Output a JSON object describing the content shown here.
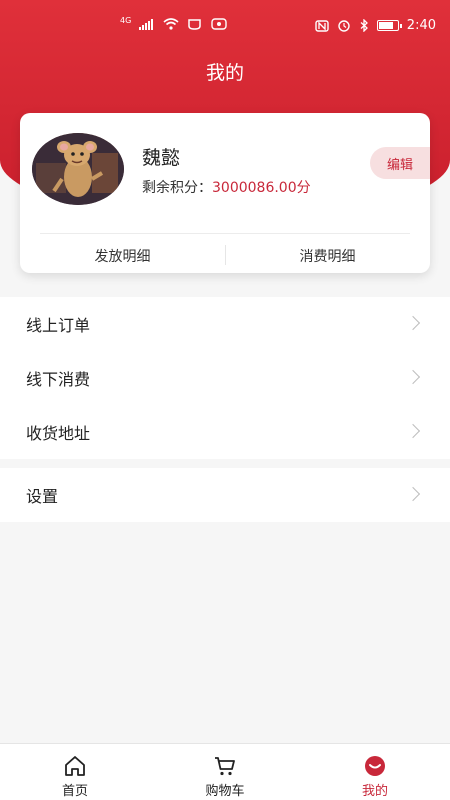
{
  "status_bar": {
    "network_label": "4G",
    "time": "2:40"
  },
  "header": {
    "title": "我的"
  },
  "profile": {
    "name": "魏懿",
    "points_label": "剩余积分：",
    "points_value": "3000086.00分",
    "edit_label": "编辑",
    "tabs": [
      {
        "label": "发放明细"
      },
      {
        "label": "消费明细"
      }
    ]
  },
  "menu": {
    "group1": [
      {
        "label": "线上订单"
      },
      {
        "label": "线下消费"
      },
      {
        "label": "收货地址"
      }
    ],
    "group2": [
      {
        "label": "设置"
      }
    ]
  },
  "bottom_nav": {
    "items": [
      {
        "label": "首页",
        "icon": "home-icon"
      },
      {
        "label": "购物车",
        "icon": "cart-icon"
      },
      {
        "label": "我的",
        "icon": "profile-icon",
        "active": true
      }
    ]
  },
  "colors": {
    "brand": "#c8283a",
    "header_gradient_top": "#e0303a",
    "background": "#f6f6f6"
  }
}
